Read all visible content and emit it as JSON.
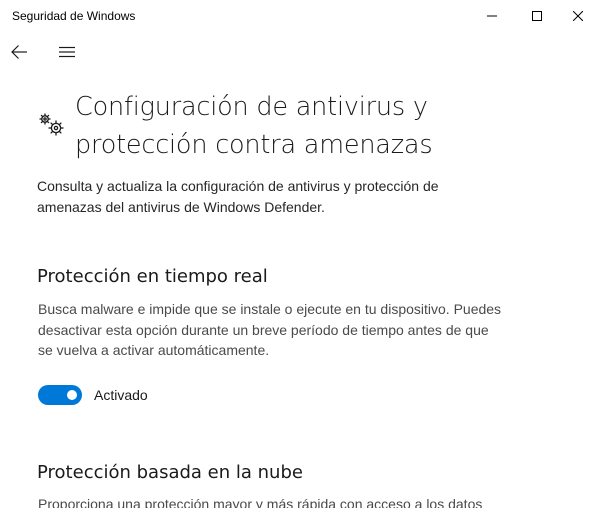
{
  "window": {
    "title": "Seguridad de Windows"
  },
  "nav": {
    "back_icon": "back-arrow-icon",
    "menu_icon": "hamburger-menu-icon"
  },
  "page": {
    "icon": "gears-icon",
    "title_line1": "Configuración de antivirus y",
    "title_line2": "protección contra amenazas",
    "description_line1": "Consulta y actualiza la configuración de antivirus y protección de",
    "description_line2": "amenazas del antivirus de Windows Defender."
  },
  "realtime": {
    "title": "Protección en tiempo real",
    "description_line1": "Busca malware e impide que se instale o ejecute en tu dispositivo. Puedes",
    "description_line2": "desactivar esta opción durante un breve período de tiempo antes de que",
    "description_line3": "se vuelva a activar automáticamente.",
    "toggle_on": true,
    "toggle_label": "Activado"
  },
  "cloud": {
    "title": "Protección basada en la nube",
    "description_line1": "Proporciona una protección mayor y más rápida con acceso a los datos"
  },
  "colors": {
    "accent": "#0078d7",
    "background": "#ffffff"
  }
}
